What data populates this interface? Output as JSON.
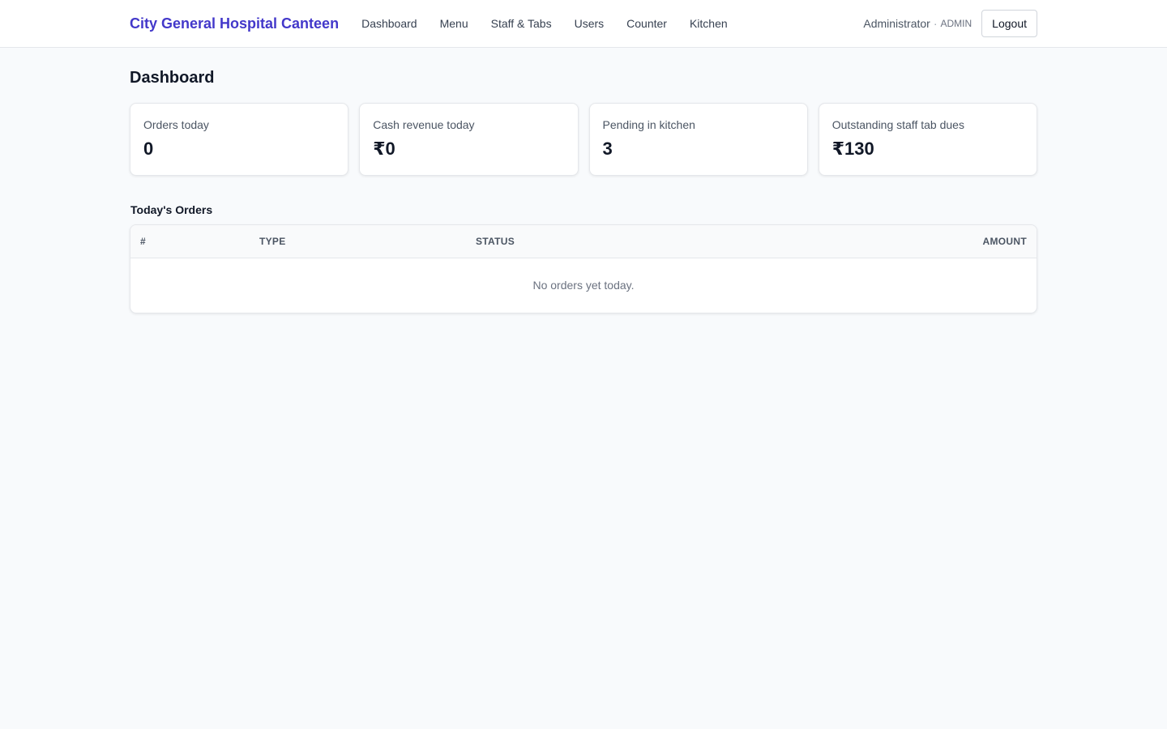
{
  "header": {
    "brand": "City General Hospital Canteen",
    "nav": [
      "Dashboard",
      "Menu",
      "Staff & Tabs",
      "Users",
      "Counter",
      "Kitchen"
    ],
    "user_name": "Administrator",
    "user_separator": "·",
    "user_role": "ADMIN",
    "logout_label": "Logout"
  },
  "page": {
    "title": "Dashboard"
  },
  "stats": [
    {
      "label": "Orders today",
      "value": "0"
    },
    {
      "label": "Cash revenue today",
      "value": "₹0"
    },
    {
      "label": "Pending in kitchen",
      "value": "3"
    },
    {
      "label": "Outstanding staff tab dues",
      "value": "₹130"
    }
  ],
  "orders": {
    "title": "Today's Orders",
    "columns": [
      "#",
      "Type",
      "Status",
      "Amount"
    ],
    "empty_message": "No orders yet today."
  },
  "colors": {
    "brand": "#4338ca",
    "background": "#f8fafc"
  }
}
